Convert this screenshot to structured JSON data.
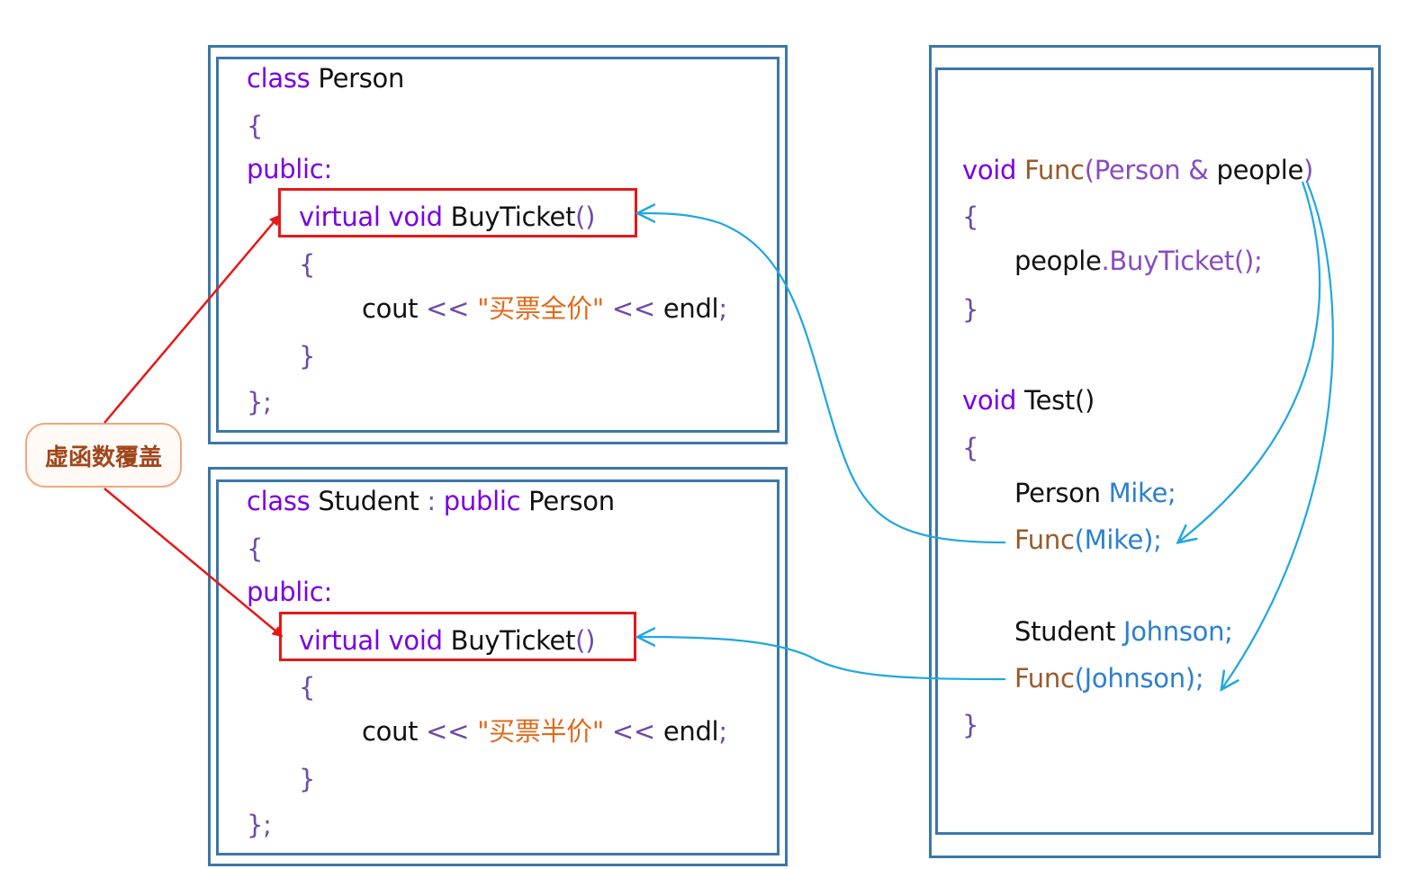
{
  "person": {
    "l1_kw": "class",
    "l1_name": " Person",
    "l2": "{",
    "l3": "public:",
    "l4_kw": "virtual void",
    "l4_fn": " BuyTicket",
    "l4_paren": "()",
    "l5": "{",
    "l6_cout": "cout",
    "l6_op": " << ",
    "l6_str": "\"买票全价\"",
    "l6_op2": " << ",
    "l6_endl": "endl",
    "l6_semi": ";",
    "l7": "}",
    "l8": "};"
  },
  "student": {
    "l1_kw": "class",
    "l1_name": " Student",
    "l1_colon": " : ",
    "l1_pub": "public",
    "l1_base": " Person",
    "l2": "{",
    "l3": "public:",
    "l4_kw": "virtual void",
    "l4_fn": " BuyTicket",
    "l4_paren": "()",
    "l5": "{",
    "l6_cout": "cout",
    "l6_op": " << ",
    "l6_str": "\"买票半价\"",
    "l6_op2": " << ",
    "l6_endl": "endl",
    "l6_semi": ";",
    "l7": "}",
    "l8": "};"
  },
  "right": {
    "f_kw": "void",
    "f_name": " Func",
    "f_open": "(Person &",
    "f_param": " people",
    "f_close": ")",
    "f_brace_open": "{",
    "f_body_obj": "people",
    "f_body_call": ".BuyTicket();",
    "f_brace_close": "}",
    "t_kw": "void",
    "t_name": " Test()",
    "t_brace_open": "{",
    "t_decl1_type": "Person",
    "t_decl1_var": " Mike;",
    "t_call1_fn": "Func",
    "t_call1_args": "(Mike);",
    "t_decl2_type": "Student",
    "t_decl2_var": " Johnson;",
    "t_call2_fn": "Func",
    "t_call2_args": "(Johnson);",
    "t_brace_close": "}"
  },
  "annotation": {
    "label": "虚函数覆盖"
  },
  "colors": {
    "box_border": "#3b77a9",
    "highlight": "#e61818",
    "arrow_blue": "#1ea7e1",
    "keyword": "#7a00e6",
    "string": "#e06a1a",
    "annotation_text": "#a1461b"
  }
}
